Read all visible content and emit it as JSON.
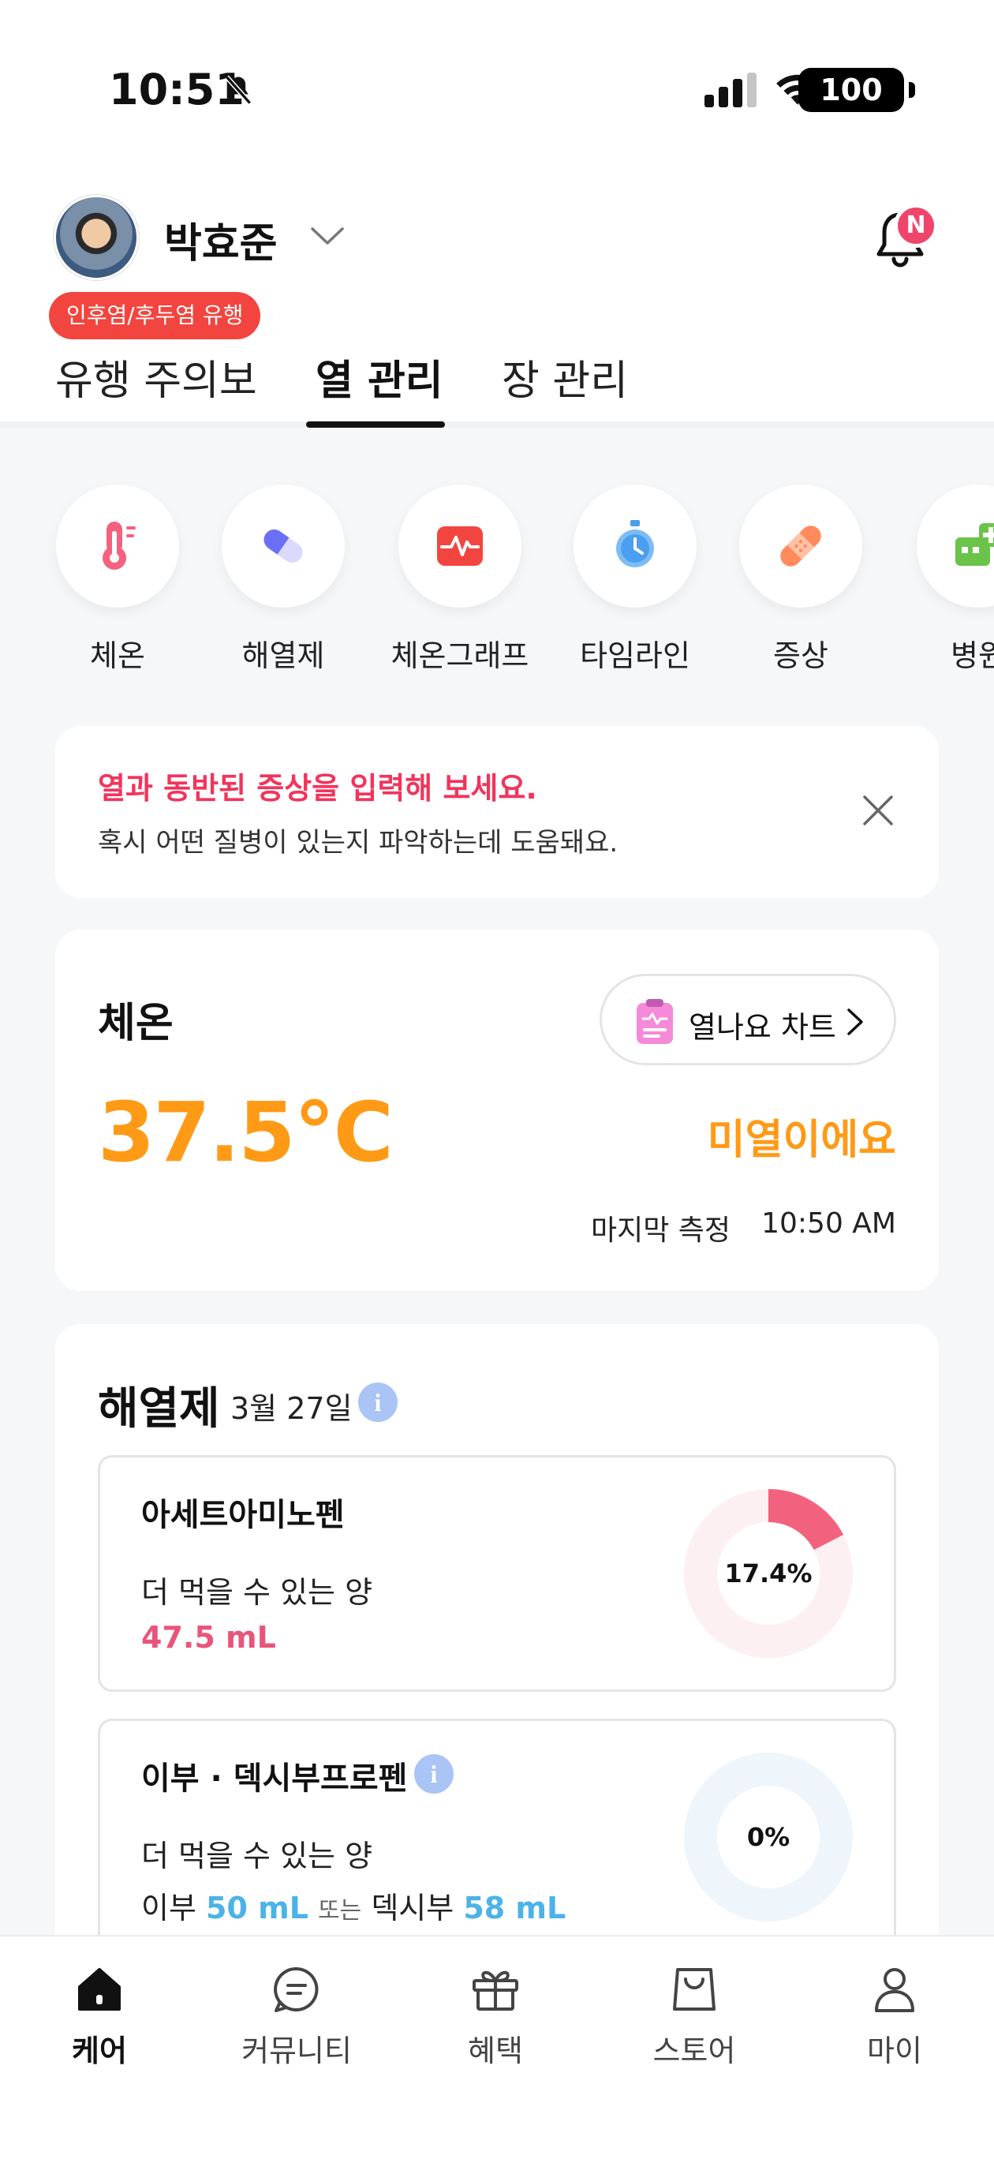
{
  "status_bar": {
    "time": "10:51",
    "battery": "100"
  },
  "profile": {
    "name": "박효준",
    "alert_badge": "인후염/후두염 유행",
    "notification_badge": "N"
  },
  "tabs": [
    {
      "label": "유행 주의보"
    },
    {
      "label": "열 관리",
      "active": true
    },
    {
      "label": "장 관리"
    }
  ],
  "quick_menu": [
    {
      "label": "체온",
      "icon": "thermometer-icon"
    },
    {
      "label": "해열제",
      "icon": "pill-icon"
    },
    {
      "label": "체온그래프",
      "icon": "heart-graph-icon"
    },
    {
      "label": "타임라인",
      "icon": "stopwatch-icon"
    },
    {
      "label": "증상",
      "icon": "bandage-icon"
    },
    {
      "label": "병원",
      "icon": "hospital-icon"
    }
  ],
  "banner": {
    "title": "열과 동반된 증상을 입력해 보세요.",
    "subtitle": "혹시 어떤 질병이 있는지 파악하는데 도움돼요."
  },
  "temperature_card": {
    "title": "체온",
    "chart_button": "열나요 차트",
    "value": "37.5°C",
    "status": "미열이에요",
    "last_label": "마지막 측정",
    "last_time": "10:50 AM",
    "accent_color": "#ff9a16"
  },
  "medicine_card": {
    "title": "해열제",
    "date": "3월 27일",
    "info": "i",
    "drugs": [
      {
        "name": "아세트아미노펜",
        "sub": "더 먹을 수 있는 양",
        "amount": "47.5 mL",
        "percent_label": "17.4%",
        "fraction": 0.174,
        "color": "#f2627f"
      },
      {
        "name": "이부 · 덱시부프로펜",
        "sub": "더 먹을 수 있는 양",
        "row_prefix_1": "이부",
        "amount_1": "50 mL",
        "or": "또는",
        "row_prefix_2": "덱시부",
        "amount_2": "58 mL",
        "percent_label": "0%",
        "fraction": 0,
        "color": "#4bb3e8"
      }
    ]
  },
  "bottom_nav": [
    {
      "label": "케어",
      "icon": "home-icon",
      "active": true
    },
    {
      "label": "커뮤니티",
      "icon": "chat-icon"
    },
    {
      "label": "혜택",
      "icon": "gift-icon"
    },
    {
      "label": "스토어",
      "icon": "shopping-bag-icon"
    },
    {
      "label": "마이",
      "icon": "person-icon"
    }
  ]
}
